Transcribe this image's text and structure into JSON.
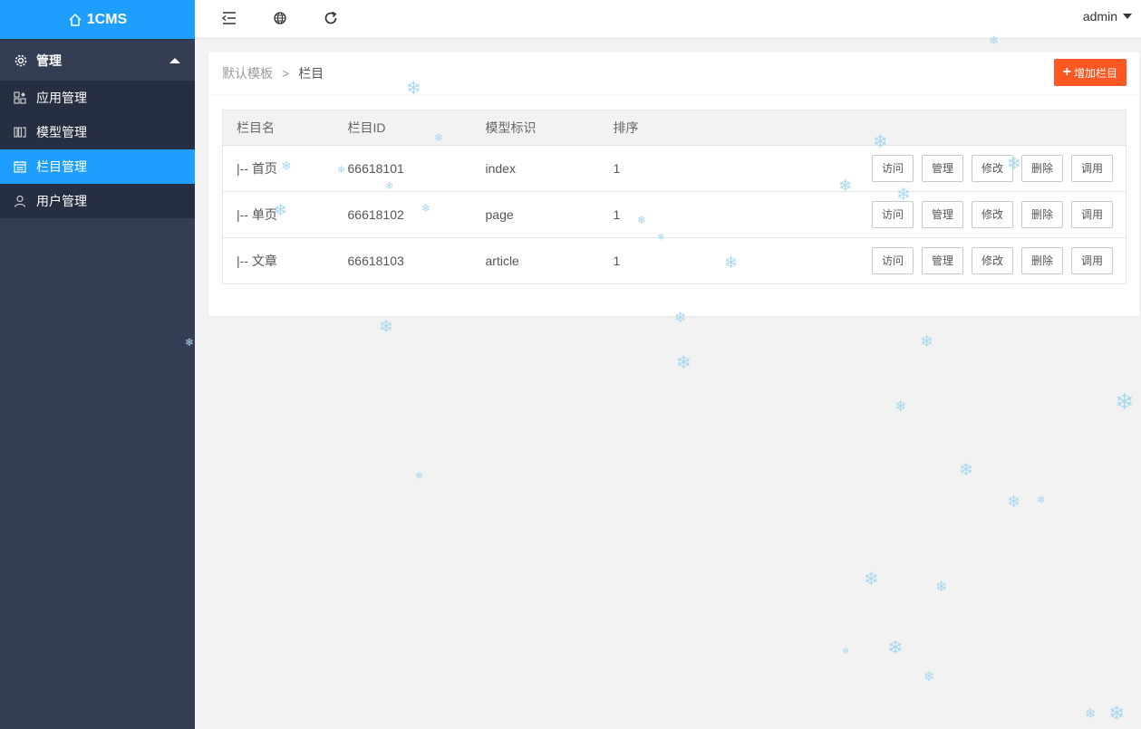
{
  "app": {
    "logo_text": "1CMS"
  },
  "sidebar": {
    "group_label": "管理",
    "items": [
      {
        "label": "应用管理",
        "icon": "apps-icon",
        "active": false
      },
      {
        "label": "模型管理",
        "icon": "model-icon",
        "active": false
      },
      {
        "label": "栏目管理",
        "icon": "calendar-icon",
        "active": true
      },
      {
        "label": "用户管理",
        "icon": "user-icon",
        "active": false
      }
    ]
  },
  "header": {
    "icons": [
      "menu-collapse-icon",
      "globe-icon",
      "refresh-icon"
    ],
    "user_label": "admin"
  },
  "breadcrumb": {
    "root": "默认模板",
    "separator": ">",
    "current": "栏目"
  },
  "add_button_label": "增加栏目",
  "table": {
    "headers": [
      "栏目名",
      "栏目ID",
      "模型标识",
      "排序"
    ],
    "rows": [
      {
        "name": "|-- 首页",
        "id": "66618101",
        "model": "index",
        "order": "1"
      },
      {
        "name": "|-- 单页",
        "id": "66618102",
        "model": "page",
        "order": "1"
      },
      {
        "name": "|-- 文章",
        "id": "66618103",
        "model": "article",
        "order": "1"
      }
    ],
    "row_actions": [
      "访问",
      "管理",
      "修改",
      "删除",
      "调用"
    ]
  },
  "colors": {
    "sidebar_bg": "#333d54",
    "accent": "#1e9fff",
    "add_button": "#ff5722",
    "snow": "#a8d8f0"
  }
}
